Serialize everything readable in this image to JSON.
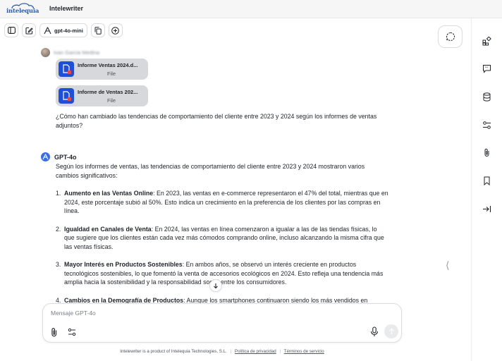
{
  "app": {
    "brand_text": "intelequia",
    "title": "Intelewriter"
  },
  "toolbar": {
    "model_label": "gpt-4o-mini"
  },
  "conversation": {
    "user_name": "Ivan Garcia Medina",
    "files": [
      {
        "name": "Informe Ventas 2024.d...",
        "type": "File"
      },
      {
        "name": "Informe de Ventas 202...",
        "type": "File"
      }
    ],
    "question": "¿Cómo han cambiado las tendencias de comportamiento del cliente entre 2023 y 2024 según los informes de ventas adjuntos?",
    "assistant_name": "GPT-4o",
    "intro": "Según los informes de ventas, las tendencias de comportamiento del cliente entre 2023 y 2024 mostraron varios cambios significativos:",
    "items": [
      {
        "num": "1.",
        "title": "Aumento en las Ventas Online",
        "text": ": En 2023, las ventas en e-commerce representaron el 47% del total, mientras que en 2024, este porcentaje subió al 50%. Esto indica un crecimiento en la preferencia de los clientes por las compras en línea."
      },
      {
        "num": "2.",
        "title": "Igualdad en Canales de Venta",
        "text": ": En 2024, las ventas en línea comenzaron a igualar a las de las tiendas físicas, lo que sugiere que los clientes están cada vez más cómodos comprando online, incluso alcanzando la misma cifra que las ventas físicas."
      },
      {
        "num": "3.",
        "title": "Mayor Interés en Productos Sostenibles",
        "text": ": En ambos años, se observó un interés creciente en productos tecnológicos sostenibles, lo que fomentó la venta de accesorios ecológicos en 2024. Esto refleja una tendencia más amplia hacia la sostenibilidad y la responsabilidad social entre los consumidores."
      },
      {
        "num": "4.",
        "title": "Cambios en la Demografía de Productos",
        "text": ": Aunque los smartphones continuaron siendo los más vendidos en"
      }
    ]
  },
  "composer": {
    "placeholder": "Mensaje GPT-4o"
  },
  "footer": {
    "text": "Intelewriter is a product of Intelequia Technologies, S.L.",
    "privacy": "Política de privacidad",
    "terms": "Términos de servicio"
  },
  "colors": {
    "brand_blue": "#2a5db0",
    "file_icon_blue": "#1f4fd6",
    "file_card_bg": "#d7d8db",
    "topbar_bg": "#f6f6f7"
  }
}
